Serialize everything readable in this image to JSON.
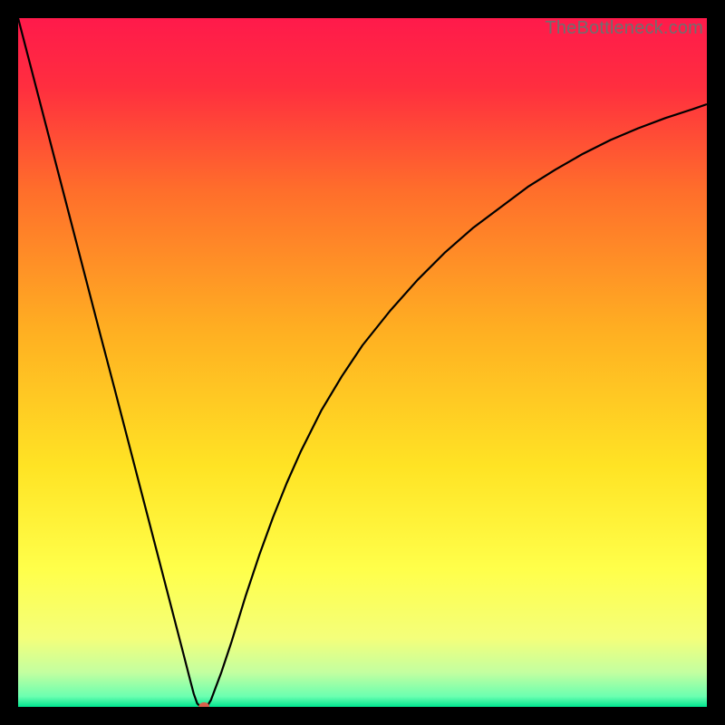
{
  "watermark": "TheBottleneck.com",
  "chart_data": {
    "type": "line",
    "title": "",
    "xlabel": "",
    "ylabel": "",
    "xlim": [
      0,
      100
    ],
    "ylim": [
      0,
      100
    ],
    "background_gradient": {
      "stops": [
        {
          "offset": 0.0,
          "color": "#ff1a4b"
        },
        {
          "offset": 0.1,
          "color": "#ff2e3f"
        },
        {
          "offset": 0.25,
          "color": "#ff6e2b"
        },
        {
          "offset": 0.45,
          "color": "#ffae22"
        },
        {
          "offset": 0.65,
          "color": "#ffe324"
        },
        {
          "offset": 0.8,
          "color": "#ffff4a"
        },
        {
          "offset": 0.9,
          "color": "#f4ff7a"
        },
        {
          "offset": 0.95,
          "color": "#c3ffa0"
        },
        {
          "offset": 0.985,
          "color": "#6bffb0"
        },
        {
          "offset": 1.0,
          "color": "#00e58f"
        }
      ]
    },
    "series": [
      {
        "name": "bottleneck-curve",
        "x": [
          0.0,
          2,
          4,
          6,
          8,
          10,
          12,
          14,
          16,
          18,
          20,
          22,
          24,
          25,
          25.5,
          26,
          26.5,
          27,
          27.5,
          28,
          29.5,
          31,
          33,
          35,
          37,
          39,
          41,
          44,
          47,
          50,
          54,
          58,
          62,
          66,
          70,
          74,
          78,
          82,
          86,
          90,
          94,
          98,
          100
        ],
        "y": [
          100,
          92.3,
          84.6,
          76.9,
          69.2,
          61.5,
          53.8,
          46.2,
          38.5,
          30.8,
          23.1,
          15.4,
          7.7,
          3.8,
          1.9,
          0.5,
          0.0,
          0.0,
          0.2,
          1.0,
          5.0,
          9.5,
          16.0,
          22.0,
          27.5,
          32.5,
          37.0,
          43.0,
          48.0,
          52.5,
          57.5,
          62.0,
          66.0,
          69.5,
          72.5,
          75.5,
          78.0,
          80.3,
          82.3,
          84.0,
          85.5,
          86.8,
          87.5
        ]
      }
    ],
    "marker": {
      "x": 27,
      "y": 0,
      "color": "#d9604c",
      "radius": 6
    }
  }
}
